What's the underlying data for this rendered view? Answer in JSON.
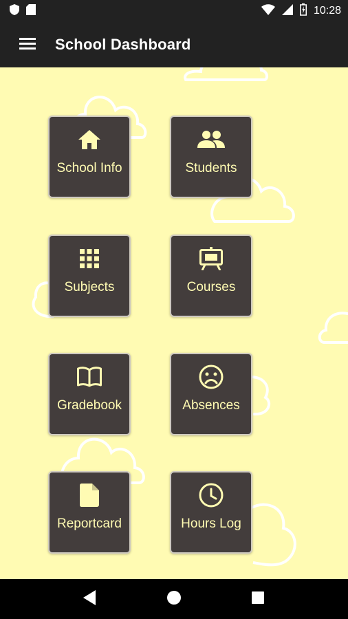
{
  "status_bar": {
    "time": "10:28",
    "icons": [
      "shield-icon",
      "sd-card-icon",
      "wifi-icon",
      "signal-icon",
      "battery-icon"
    ]
  },
  "app_bar": {
    "title": "School Dashboard",
    "menu_icon": "menu-icon"
  },
  "dashboard": {
    "tiles": [
      {
        "label": "School Info",
        "icon": "home-icon"
      },
      {
        "label": "Students",
        "icon": "people-icon"
      },
      {
        "label": "Subjects",
        "icon": "grid-icon"
      },
      {
        "label": "Courses",
        "icon": "easel-icon"
      },
      {
        "label": "Gradebook",
        "icon": "book-icon"
      },
      {
        "label": "Absences",
        "icon": "sad-face-icon"
      },
      {
        "label": "Reportcard",
        "icon": "document-icon"
      },
      {
        "label": "Hours Log",
        "icon": "clock-icon"
      }
    ]
  },
  "nav_bar": {
    "icons": [
      "back-icon",
      "home-icon",
      "recents-icon"
    ]
  },
  "colors": {
    "background": "#fffbb3",
    "tile": "#433d3c",
    "tile_text": "#fffbb3",
    "app_bar": "#222222"
  }
}
